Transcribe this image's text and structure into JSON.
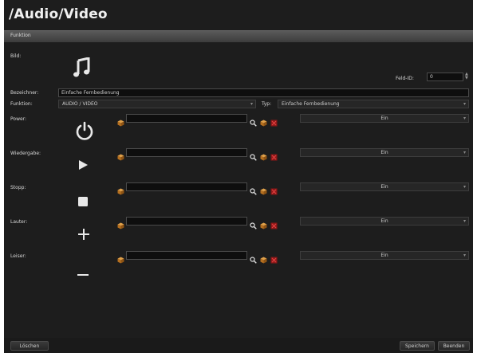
{
  "title": "/Audio/Video",
  "section": {
    "label": "Funktion"
  },
  "form": {
    "bild_label": "Bild:",
    "feld_id_label": "Feld-ID:",
    "feld_id_value": "0",
    "bezeichner_label": "Bezeichner:",
    "bezeichner_value": "Einfache Fernbedienung",
    "funktion_label": "Funktion:",
    "funktion_value": "AUDIO / VIDEO",
    "typ_label": "Typ:",
    "typ_value": "Einfache Fernbedienung"
  },
  "rows": [
    {
      "label": "Power:",
      "icon": "power-icon",
      "command_value": "",
      "state": "Ein"
    },
    {
      "label": "Wiedergabe:",
      "icon": "play-icon",
      "command_value": "",
      "state": "Ein"
    },
    {
      "label": "Stopp:",
      "icon": "stop-icon",
      "command_value": "",
      "state": "Ein"
    },
    {
      "label": "Lauter:",
      "icon": "plus-icon",
      "command_value": "",
      "state": "Ein"
    },
    {
      "label": "Leiser:",
      "icon": "minus-icon",
      "command_value": "",
      "state": "Ein"
    }
  ],
  "buttons": {
    "delete": "Löschen",
    "save": "Speichern",
    "quit": "Beenden"
  },
  "colors": {
    "background": "#1d1d1d",
    "field_background": "#0e0e0e",
    "cube_icon": "#c9822a",
    "delete_icon": "#a02020"
  }
}
